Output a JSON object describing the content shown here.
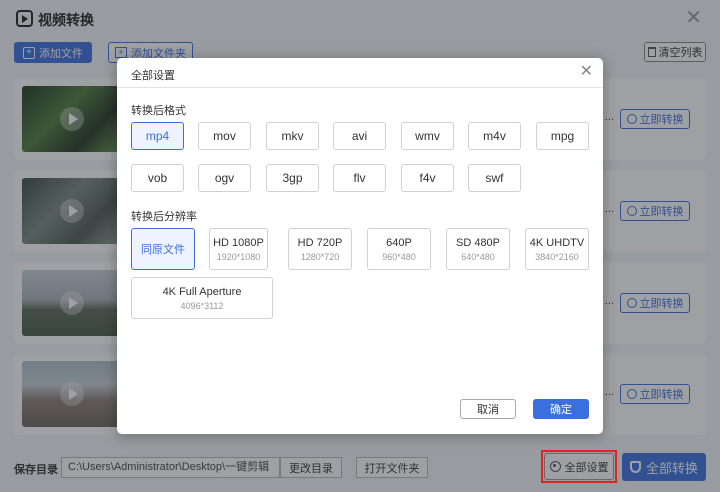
{
  "app": {
    "title": "视频转换",
    "add_file_label": "添加文件",
    "add_folder_label": "添加文件夹",
    "clear_list_label": "清空列表",
    "row_convert_label": "立即转换",
    "row_fragment": "..."
  },
  "footer": {
    "save_dir_label": "保存目录",
    "path_value": "C:\\Users\\Administrator\\Desktop\\一键剪辑",
    "change_dir_label": "更改目录",
    "open_folder_label": "打开文件夹",
    "all_settings_label": "全部设置",
    "all_convert_label": "全部转换"
  },
  "modal": {
    "title": "全部设置",
    "format_section_label": "转换后格式",
    "resolution_section_label": "转换后分辨率",
    "formats": [
      "mp4",
      "mov",
      "mkv",
      "avi",
      "wmv",
      "m4v",
      "mpg",
      "vob",
      "ogv",
      "3gp",
      "flv",
      "f4v",
      "swf"
    ],
    "selected_format": "mp4",
    "resolutions": [
      {
        "name": "同原文件",
        "dim": ""
      },
      {
        "name": "HD 1080P",
        "dim": "1920*1080"
      },
      {
        "name": "HD 720P",
        "dim": "1280*720"
      },
      {
        "name": "640P",
        "dim": "960*480"
      },
      {
        "name": "SD 480P",
        "dim": "640*480"
      },
      {
        "name": "4K UHDTV",
        "dim": "3840*2160"
      },
      {
        "name": "4K Full Aperture",
        "dim": "4096*3112"
      }
    ],
    "selected_resolution": "同原文件",
    "cancel_label": "取消",
    "ok_label": "确定"
  },
  "colors": {
    "accent": "#3b6fe0",
    "highlight": "#e02424"
  }
}
